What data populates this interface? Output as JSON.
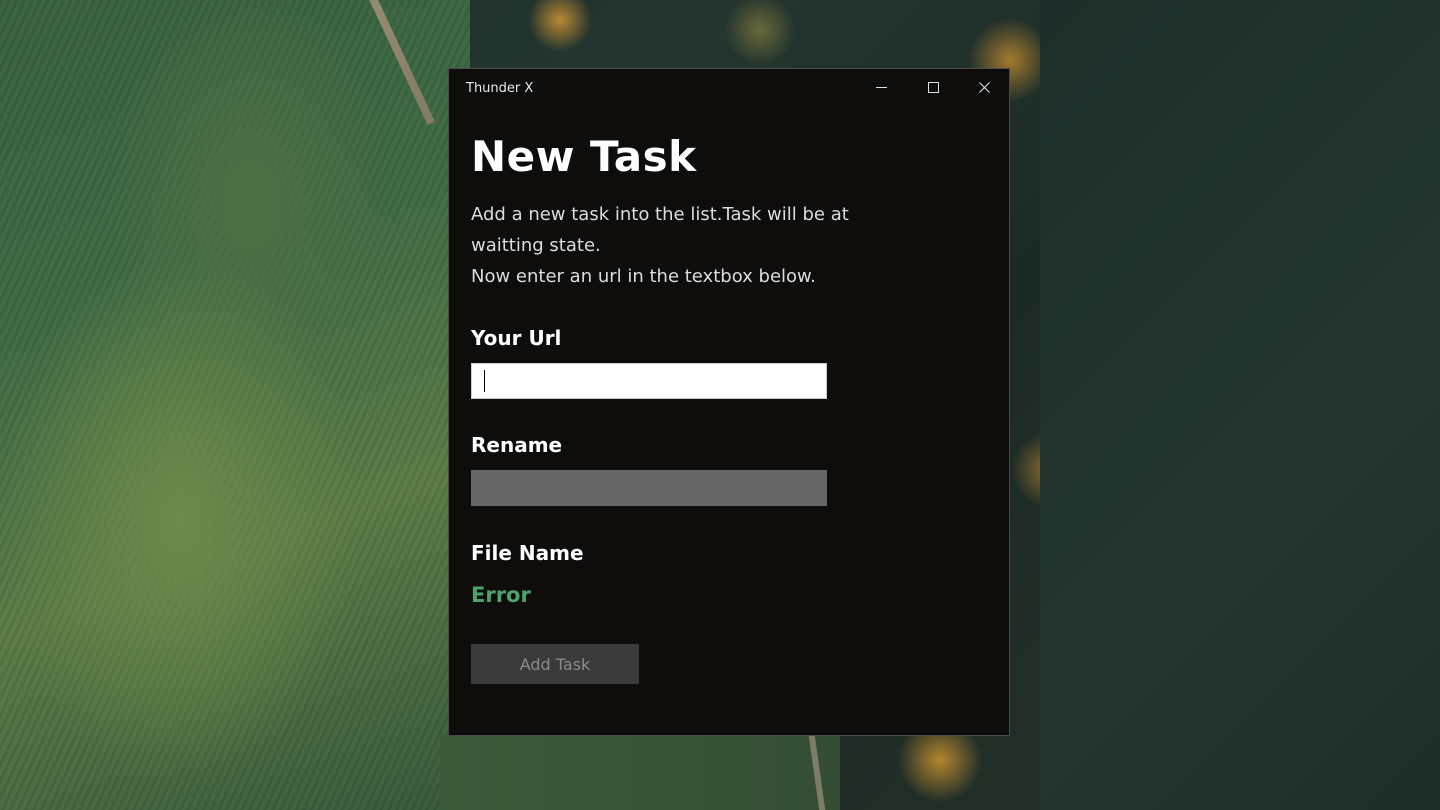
{
  "window": {
    "app_title": "Thunder X",
    "minimize_icon": "minimize-icon",
    "maximize_icon": "maximize-icon",
    "close_icon": "close-icon"
  },
  "page": {
    "title": "New Task",
    "description_lines": [
      "Add a new task into the list.Task will be at waitting state.",
      "Now enter an url in the textbox below."
    ]
  },
  "form": {
    "url_label": "Your Url",
    "url_value": "",
    "rename_label": "Rename",
    "rename_value": "",
    "file_name_label": "File Name",
    "file_name_value": "Error",
    "add_task_label": "Add Task"
  },
  "colors": {
    "window_bg": "#0f0d0c",
    "error_text": "#4fa36a",
    "button_bg": "#3a3a3a",
    "button_text": "#8a8a8a",
    "disabled_input": "#666666"
  }
}
